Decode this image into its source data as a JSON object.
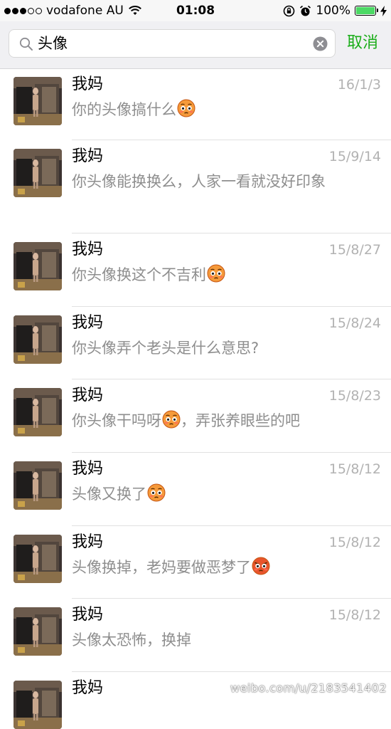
{
  "status_bar": {
    "carrier": "vodafone AU",
    "time": "01:08",
    "battery": "100%",
    "battery_level": 1.0
  },
  "search": {
    "query": "头像",
    "cancel_label": "取消",
    "accent_color": "#1aad19"
  },
  "results": [
    {
      "name": "我妈",
      "date": "16/1/3",
      "message": "你的头像搞什么",
      "emoji": "flushed-face"
    },
    {
      "name": "我妈",
      "date": "15/9/14",
      "message": "你头像能换换么，人家一看就没好印象",
      "emoji": ""
    },
    {
      "name": "我妈",
      "date": "15/8/27",
      "message": "你头像换这个不吉利",
      "emoji": "flushed-face"
    },
    {
      "name": "我妈",
      "date": "15/8/24",
      "message": "你头像弄个老头是什么意思?",
      "emoji": ""
    },
    {
      "name": "我妈",
      "date": "15/8/23",
      "message": "你头像干吗呀",
      "emoji": "flushed-face",
      "message_tail": "，弄张养眼些的吧"
    },
    {
      "name": "我妈",
      "date": "15/8/12",
      "message": "头像又换了",
      "emoji": "flushed-face"
    },
    {
      "name": "我妈",
      "date": "15/8/12",
      "message": "头像换掉，老妈要做恶梦了",
      "emoji": "angry-face"
    },
    {
      "name": "我妈",
      "date": "15/8/12",
      "message": "头像太恐怖，换掉",
      "emoji": ""
    },
    {
      "name": "我妈",
      "date": "",
      "message": "",
      "emoji": ""
    }
  ],
  "watermark": "weibo.com/u/2183541402"
}
